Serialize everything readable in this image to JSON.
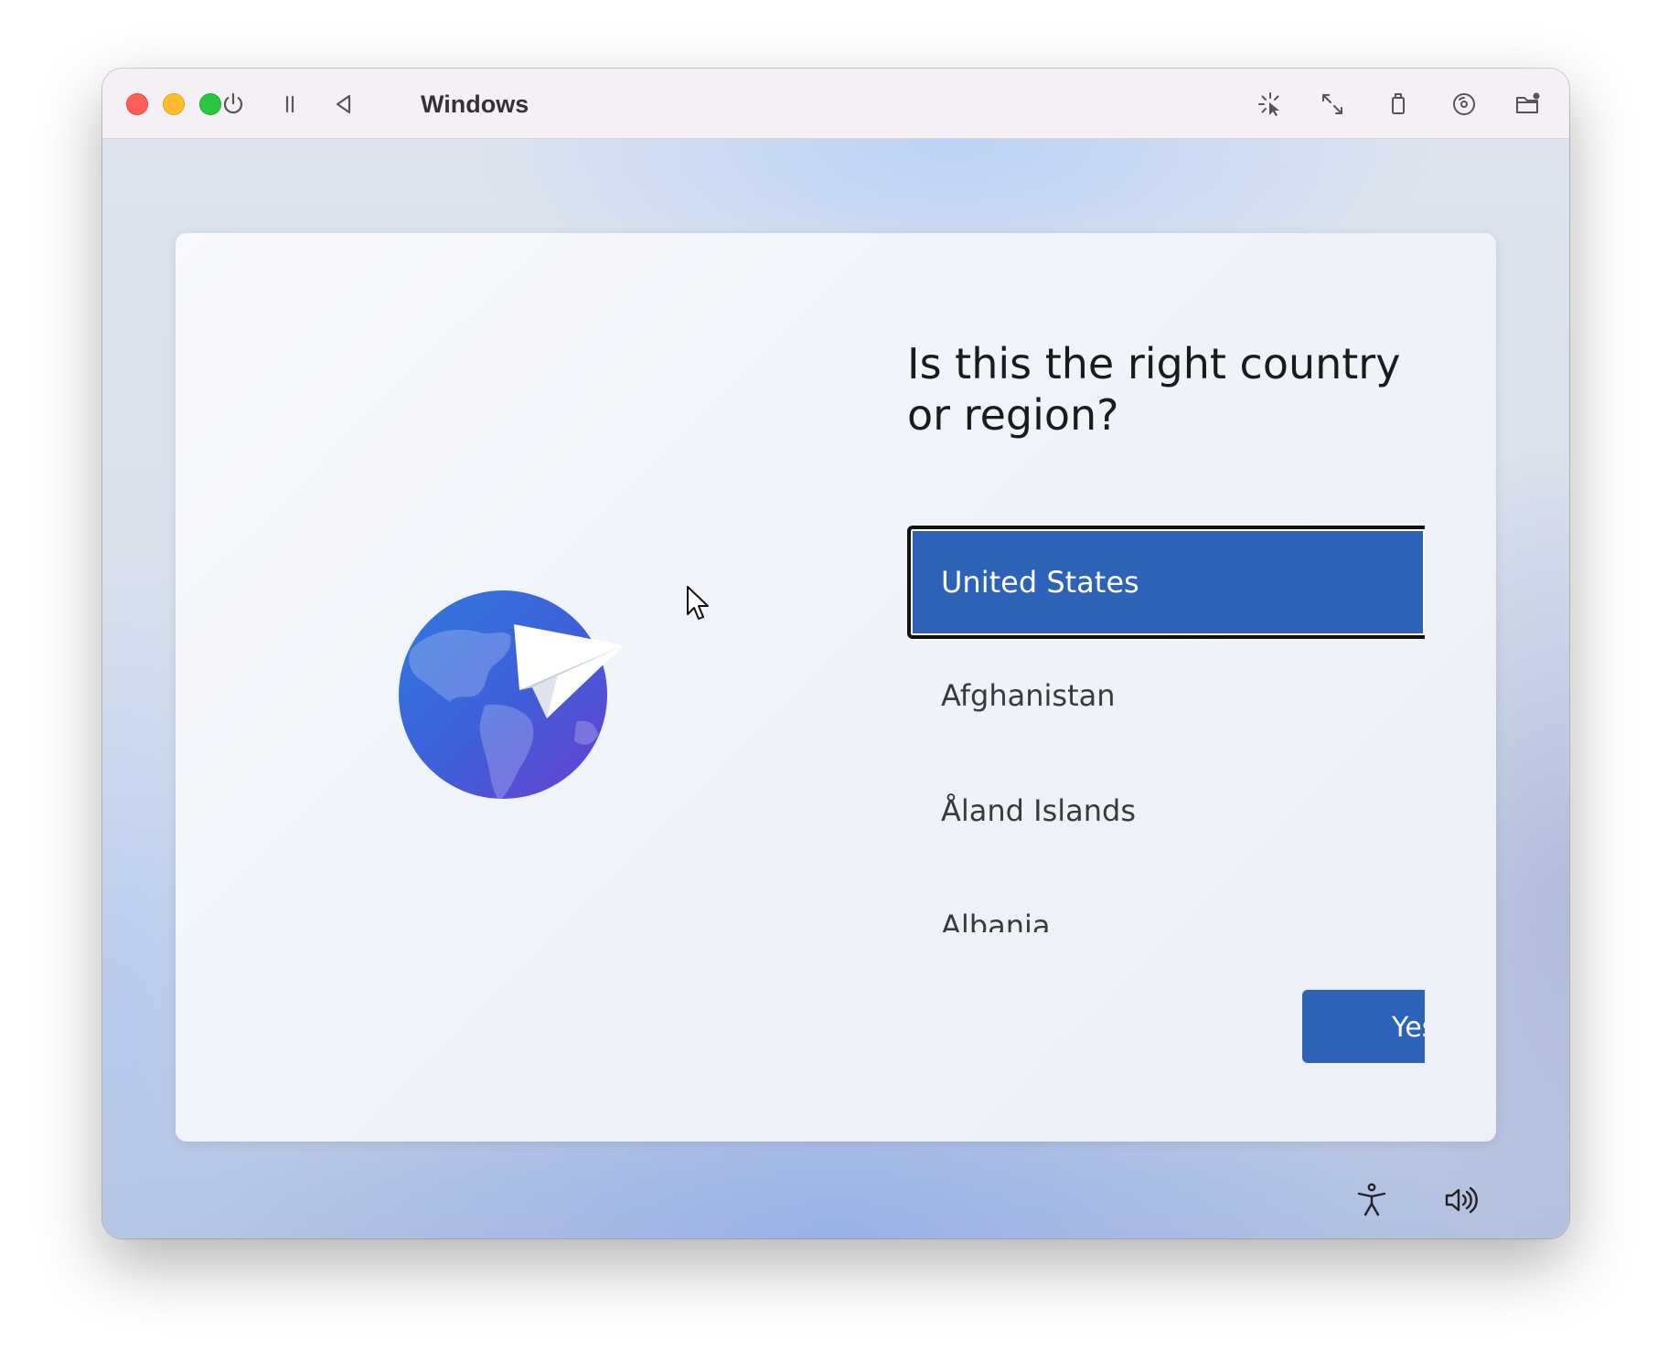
{
  "window": {
    "title": "Windows"
  },
  "toolbar": {
    "icons": [
      "power-icon",
      "pause-icon",
      "back-icon",
      "capture-pointer-icon",
      "resize-icon",
      "usb-icon",
      "disc-icon",
      "shared-folder-icon"
    ]
  },
  "setup": {
    "question": "Is this the right country or region?",
    "countries": [
      {
        "label": "United States",
        "selected": true
      },
      {
        "label": "Afghanistan",
        "selected": false
      },
      {
        "label": "Åland Islands",
        "selected": false
      },
      {
        "label": "Albania",
        "selected": false
      }
    ],
    "yes_label": "Yes"
  },
  "taskbar": {
    "icons": [
      "accessibility-icon",
      "volume-icon"
    ]
  },
  "colors": {
    "accent": "#2c63b8",
    "close": "#ff5f57",
    "minimize": "#febc2e",
    "zoom": "#28c840"
  }
}
